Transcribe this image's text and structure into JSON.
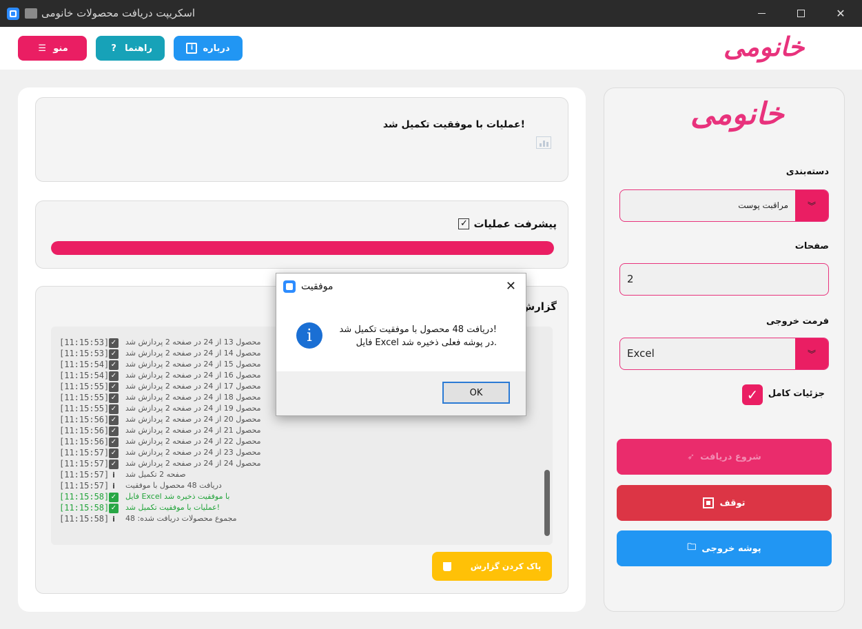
{
  "window": {
    "title": "اسکریپت دریافت محصولات خانومی"
  },
  "header": {
    "logo_text": "خانومی",
    "menu_label": "منو",
    "help_label": "راهنما",
    "about_label": "درباره"
  },
  "sidebar": {
    "logo_text": "خانومی",
    "category_label": "دسته‌بندی",
    "category_value": "مراقبت پوست",
    "pages_label": "صفحات",
    "pages_value": "2",
    "format_label": "فرمت خروجی",
    "format_value": "Excel",
    "details_label": "جزئیات کامل",
    "details_checked": true,
    "start_label": "شروع دریافت",
    "stop_label": "توقف",
    "folder_label": "پوشه خروجی"
  },
  "status": {
    "message": "!عملیات با موفقیت تکمیل شد"
  },
  "progress": {
    "title": "پیشرفت عملیات",
    "percent": 100
  },
  "report": {
    "title": "گزارش",
    "clear_label": "پاک کردن گزارش",
    "rows": [
      {
        "ts": "[11:15:53]",
        "icon": "check",
        "msg": "محصول 13 از 24 در صفحه 2 پردازش شد"
      },
      {
        "ts": "[11:15:53]",
        "icon": "check",
        "msg": "محصول 14 از 24 در صفحه 2 پردازش شد"
      },
      {
        "ts": "[11:15:54]",
        "icon": "check",
        "msg": "محصول 15 از 24 در صفحه 2 پردازش شد"
      },
      {
        "ts": "[11:15:54]",
        "icon": "check",
        "msg": "محصول 16 از 24 در صفحه 2 پردازش شد"
      },
      {
        "ts": "[11:15:55]",
        "icon": "check",
        "msg": "محصول 17 از 24 در صفحه 2 پردازش شد"
      },
      {
        "ts": "[11:15:55]",
        "icon": "check",
        "msg": "محصول 18 از 24 در صفحه 2 پردازش شد"
      },
      {
        "ts": "[11:15:55]",
        "icon": "check",
        "msg": "محصول 19 از 24 در صفحه 2 پردازش شد"
      },
      {
        "ts": "[11:15:56]",
        "icon": "check",
        "msg": "محصول 20 از 24 در صفحه 2 پردازش شد"
      },
      {
        "ts": "[11:15:56]",
        "icon": "check",
        "msg": "محصول 21 از 24 در صفحه 2 پردازش شد"
      },
      {
        "ts": "[11:15:56]",
        "icon": "check",
        "msg": "محصول 22 از 24 در صفحه 2 پردازش شد"
      },
      {
        "ts": "[11:15:57]",
        "icon": "check",
        "msg": "محصول 23 از 24 در صفحه 2 پردازش شد"
      },
      {
        "ts": "[11:15:57]",
        "icon": "check",
        "msg": "محصول 24 از 24 در صفحه 2 پردازش شد"
      },
      {
        "ts": "[11:15:57]",
        "icon": "info",
        "msg": "صفحه 2 تکمیل شد"
      },
      {
        "ts": "[11:15:57]",
        "icon": "info",
        "msg": "دریافت 48 محصول با موفقیت"
      },
      {
        "ts": "[11:15:58]",
        "icon": "ok",
        "msg": "با موفقیت ذخیره شد Excel فایل"
      },
      {
        "ts": "[11:15:58]",
        "icon": "ok",
        "msg": "!عملیات با موفقیت تکمیل شد"
      },
      {
        "ts": "[11:15:58]",
        "icon": "info",
        "msg": "مجموع محصولات دریافت شده: 48"
      }
    ]
  },
  "dialog": {
    "title": "موفقیت",
    "line1": "!دریافت 48 محصول با موفقیت تکمیل شد",
    "line2": ".در پوشه فعلی ذخیره شد Excel فایل",
    "ok_label": "OK"
  },
  "colors": {
    "brand": "#ea1e63",
    "help": "#17a2b8",
    "about": "#2196f3",
    "stop": "#dc3545",
    "clear": "#ffc107",
    "success": "#28a745"
  }
}
